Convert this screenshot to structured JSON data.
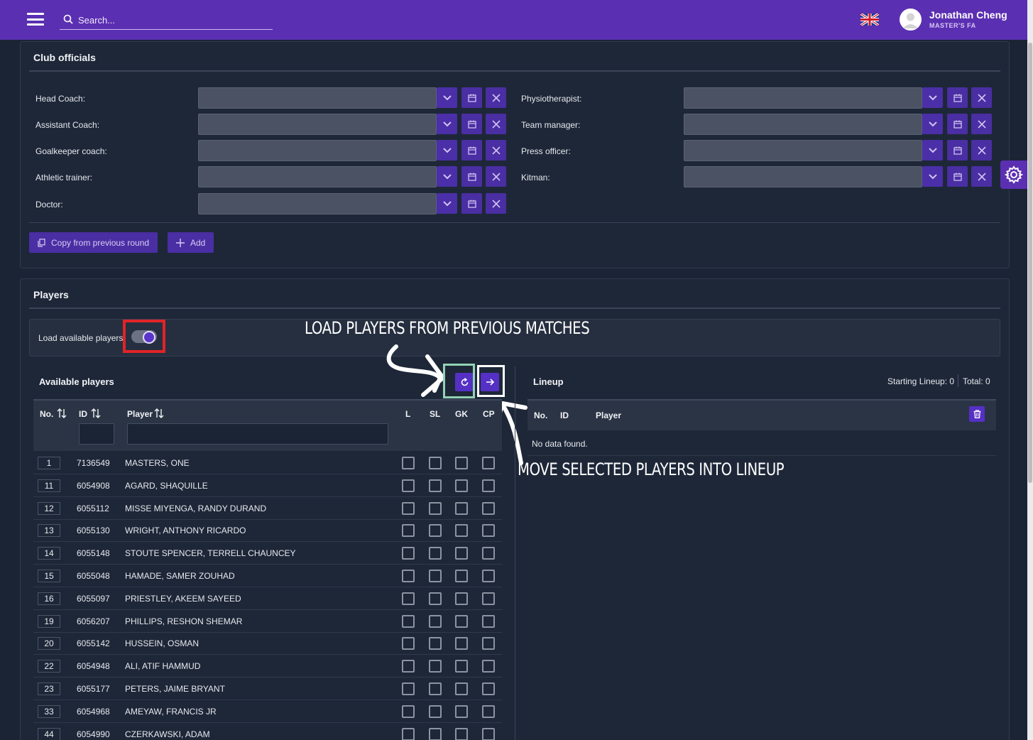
{
  "header": {
    "search_placeholder": "Search...",
    "user_name": "Jonathan Cheng",
    "user_org": "MASTER'S FA"
  },
  "club_officials": {
    "title": "Club officials",
    "left_fields": [
      {
        "label": "Head Coach:"
      },
      {
        "label": "Assistant Coach:"
      },
      {
        "label": "Goalkeeper coach:"
      },
      {
        "label": "Athletic trainer:"
      },
      {
        "label": "Doctor:"
      }
    ],
    "right_fields": [
      {
        "label": "Physiotherapist:"
      },
      {
        "label": "Team manager:"
      },
      {
        "label": "Press officer:"
      },
      {
        "label": "Kitman:"
      }
    ],
    "copy_button": "Copy from previous round",
    "add_button": "Add"
  },
  "players": {
    "title": "Players",
    "load_label": "Load available players:",
    "load_toggle_on": true,
    "available_title": "Available players",
    "columns": {
      "no": "No.",
      "id": "ID",
      "player": "Player",
      "l": "L",
      "sl": "SL",
      "gk": "GK",
      "cp": "CP"
    },
    "rows": [
      {
        "no": "1",
        "id": "7136549",
        "name": "MASTERS, ONE"
      },
      {
        "no": "11",
        "id": "6054908",
        "name": "AGARD, SHAQUILLE"
      },
      {
        "no": "12",
        "id": "6055112",
        "name": "MISSE MIYENGA, RANDY DURAND"
      },
      {
        "no": "13",
        "id": "6055130",
        "name": "WRIGHT, ANTHONY RICARDO"
      },
      {
        "no": "14",
        "id": "6055148",
        "name": "STOUTE SPENCER, TERRELL CHAUNCEY"
      },
      {
        "no": "15",
        "id": "6055048",
        "name": "HAMADE, SAMER ZOUHAD"
      },
      {
        "no": "16",
        "id": "6055097",
        "name": "PRIESTLEY, AKEEM SAYEED"
      },
      {
        "no": "19",
        "id": "6056207",
        "name": "PHILLIPS, RESHON SHEMAR"
      },
      {
        "no": "20",
        "id": "6055142",
        "name": "HUSSEIN, OSMAN"
      },
      {
        "no": "22",
        "id": "6054948",
        "name": "ALI, ATIF HAMMUD"
      },
      {
        "no": "23",
        "id": "6055177",
        "name": "PETERS, JAIME BRYANT"
      },
      {
        "no": "33",
        "id": "6054968",
        "name": "AMEYAW, FRANCIS JR"
      },
      {
        "no": "44",
        "id": "6054990",
        "name": "CZERKAWSKI, ADAM"
      }
    ],
    "lineup": {
      "title": "Lineup",
      "starting": "Starting Lineup: 0",
      "total": "Total: 0",
      "col_no": "No.",
      "col_id": "ID",
      "col_player": "Player",
      "empty": "No data found."
    }
  },
  "annotations": {
    "load_text": "LOAD PLAYERS FROM PREVIOUS MATCHES",
    "move_text": "MOVE SELECTED PLAYERS INTO LINEUP"
  },
  "colors": {
    "topbar": "#5b2fb2",
    "accent_button": "#4a2ea3",
    "background": "#1b2434",
    "highlight_red": "#e02427",
    "highlight_green": "#92d2b3"
  }
}
